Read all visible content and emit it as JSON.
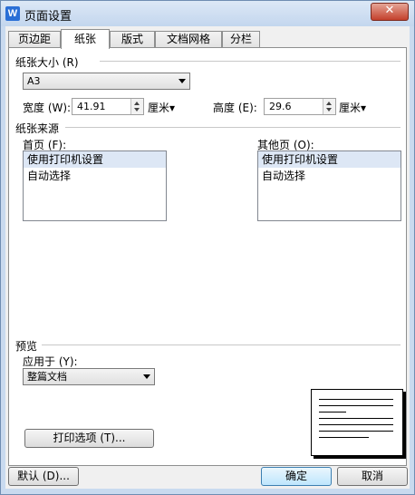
{
  "window": {
    "title": "页面设置",
    "app_icon_letter": "W",
    "close_glyph": "✕"
  },
  "tabs": [
    {
      "label": "页边距",
      "active": false
    },
    {
      "label": "纸张",
      "active": true
    },
    {
      "label": "版式",
      "active": false
    },
    {
      "label": "文档网格",
      "active": false
    },
    {
      "label": "分栏",
      "active": false
    }
  ],
  "paper_size": {
    "section_label": "纸张大小 (R)",
    "selected": "A3",
    "width_label": "宽度 (W):",
    "width_value": "41.91",
    "width_unit": "厘米▾",
    "height_label": "高度 (E):",
    "height_value": "29.6",
    "height_unit": "厘米▾"
  },
  "paper_source": {
    "section_label": "纸张来源",
    "first_page_label": "首页 (F):",
    "first_page_items": [
      "使用打印机设置",
      "自动选择"
    ],
    "first_page_selected": 0,
    "other_pages_label": "其他页 (O):",
    "other_pages_items": [
      "使用打印机设置",
      "自动选择"
    ],
    "other_pages_selected": 0
  },
  "preview": {
    "section_label": "预览",
    "apply_to_label": "应用于 (Y):",
    "apply_to_selected": "整篇文档",
    "print_options_label": "打印选项 (T)..."
  },
  "footer": {
    "default_label": "默认 (D)...",
    "ok_label": "确定",
    "cancel_label": "取消"
  }
}
